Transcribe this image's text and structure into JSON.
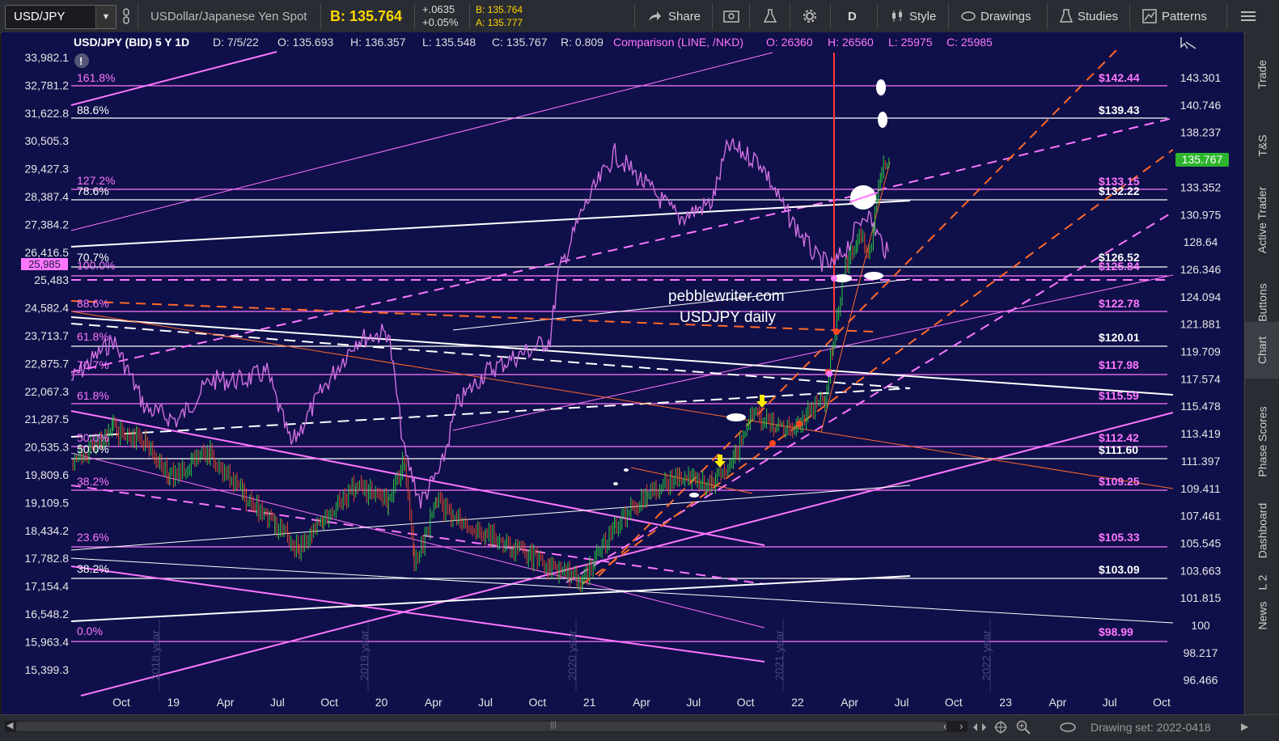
{
  "toolbar": {
    "symbol": "USD/JPY",
    "description": "USDollar/Japanese Yen Spot",
    "bid_label": "B: 135.764",
    "change": "+.0635",
    "change_pct": "+0.05%",
    "bid_small": "B: 135.764",
    "ask_small": "A: 135.777",
    "share": "Share",
    "period": "D",
    "style": "Style",
    "drawings": "Drawings",
    "studies": "Studies",
    "patterns": "Patterns"
  },
  "header": {
    "symbol_period": "USD/JPY (BID) 5 Y 1D",
    "date": "D: 7/5/22",
    "open": "O: 135.693",
    "high": "H: 136.357",
    "low": "L: 135.548",
    "close": "C: 135.767",
    "range": "R: 0.809",
    "comparison": "Comparison (LINE, /NKD)",
    "cmp_open": "O: 26360",
    "cmp_high": "H: 26560",
    "cmp_low": "L: 25975",
    "cmp_close": "C: 25985"
  },
  "left_axis": [
    "33,982.1",
    "32,781.2",
    "31,622.8",
    "30,505.3",
    "29,427.3",
    "28,387.4",
    "27,384.2",
    "26,416.5",
    "25,483",
    "24,582.4",
    "23,713.7",
    "22,875.7",
    "22,067.3",
    "21,287.5",
    "20,535.3",
    "19,809.6",
    "19,109.5",
    "18,434.2",
    "17,782.8",
    "17,154.4",
    "16,548.2",
    "15,963.4",
    "15,399.3"
  ],
  "left_badge": "25,985",
  "right_axis": [
    "143.301",
    "140.746",
    "138.237",
    "135.767",
    "133.352",
    "130.975",
    "128.64",
    "126.346",
    "124.094",
    "121.881",
    "119.709",
    "117.574",
    "115.478",
    "113.419",
    "111.397",
    "109.411",
    "107.461",
    "105.545",
    "103.663",
    "101.815",
    "100",
    "98.217",
    "96.466"
  ],
  "right_badge": "135.767",
  "x_axis": [
    "Oct",
    "19",
    "Apr",
    "Jul",
    "Oct",
    "20",
    "Apr",
    "Jul",
    "Oct",
    "21",
    "Apr",
    "Jul",
    "Oct",
    "22",
    "Apr",
    "Jul",
    "Oct",
    "23",
    "Apr",
    "Jul",
    "Oct"
  ],
  "year_labels": [
    "2018 year",
    "2019 year",
    "2020 year",
    "2021 year",
    "2022 year"
  ],
  "fib_labels": [
    {
      "text": "161.8%",
      "color": "#ff77ff"
    },
    {
      "text": "88.6%",
      "color": "#ffffff"
    },
    {
      "text": "127.2%",
      "color": "#ff77ff"
    },
    {
      "text": "78.6%",
      "color": "#ffffff"
    },
    {
      "text": "70.7%",
      "color": "#ffffff"
    },
    {
      "text": "100.0%",
      "color": "#ff77ff"
    },
    {
      "text": "88.6%",
      "color": "#ff77ff"
    },
    {
      "text": "61.8%",
      "color": "#ff77ff"
    },
    {
      "text": "70.7%",
      "color": "#ff77ff"
    },
    {
      "text": "61.8%",
      "color": "#ff77ff"
    },
    {
      "text": "50.0%",
      "color": "#ff77ff"
    },
    {
      "text": "50.0%",
      "color": "#ffffff"
    },
    {
      "text": "38.2%",
      "color": "#ff77ff"
    },
    {
      "text": "23.6%",
      "color": "#ff77ff"
    },
    {
      "text": "38.2%",
      "color": "#ffffff"
    },
    {
      "text": "0.0%",
      "color": "#ff77ff"
    }
  ],
  "price_labels": [
    {
      "text": "$142.44",
      "color": "#ff77ff"
    },
    {
      "text": "$139.43",
      "color": "#ffffff"
    },
    {
      "text": "$133.15",
      "color": "#ff77ff"
    },
    {
      "text": "$132.22",
      "color": "#ffffff"
    },
    {
      "text": "$126.52",
      "color": "#ffffff"
    },
    {
      "text": "$125.84",
      "color": "#ff77ff"
    },
    {
      "text": "$122.78",
      "color": "#ff77ff"
    },
    {
      "text": "$120.01",
      "color": "#ffffff"
    },
    {
      "text": "$117.98",
      "color": "#ff77ff"
    },
    {
      "text": "$115.59",
      "color": "#ff77ff"
    },
    {
      "text": "$112.42",
      "color": "#ff77ff"
    },
    {
      "text": "$111.60",
      "color": "#ffffff"
    },
    {
      "text": "$109.25",
      "color": "#ff77ff"
    },
    {
      "text": "$105.33",
      "color": "#ff77ff"
    },
    {
      "text": "$103.09",
      "color": "#ffffff"
    },
    {
      "text": "$98.99",
      "color": "#ff77ff"
    }
  ],
  "watermark": {
    "line1": "pebblewriter.com",
    "line2": "USDJPY daily"
  },
  "sidebar": [
    "Trade",
    "T&S",
    "Active Trader",
    "Buttons",
    "Chart",
    "Phase Scores",
    "Dashboard",
    "L 2",
    "News"
  ],
  "bottom": {
    "drawing_set": "Drawing set: 2022-0418"
  },
  "colors": {
    "chart_bg": "#0f0f4a",
    "pink": "#ff77ff",
    "orange": "#ff6a2a",
    "white": "#ffffff",
    "candle_up": "#2ecc40",
    "candle_down": "#e14b2b",
    "price_badge": "#2db52d"
  }
}
